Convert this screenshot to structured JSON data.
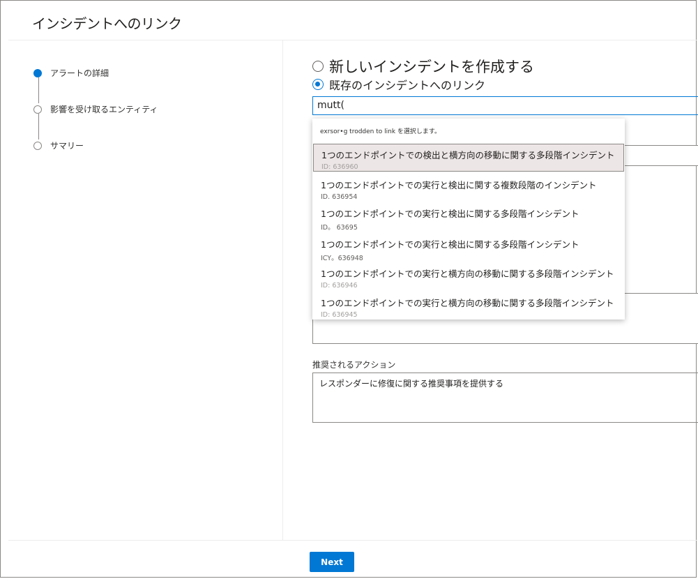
{
  "window": {
    "title": "インシデントへのリンク"
  },
  "steps": [
    {
      "label": "アラートの詳細",
      "active": true
    },
    {
      "label": "影響を受け取るエンティティ",
      "active": false
    },
    {
      "label": "サマリー",
      "active": false
    }
  ],
  "options": {
    "create_new": "新しいインシデントを作成する",
    "link_existing": "既存のインシデントへのリンク",
    "selected": "link_existing"
  },
  "search": {
    "value": "mutt("
  },
  "dropdown": {
    "hint": "exrsor•g trodden to link を選択します。",
    "items": [
      {
        "title": "1つのエンドポイントでの検出と横方向の移動に関する多段階インシデント",
        "id": "ID: 636960",
        "selected": true
      },
      {
        "title": "1つのエンドポイントでの実行と検出に関する複数段階のインシデント",
        "id": "ID. 636954",
        "selected": false
      },
      {
        "title": "1つのエンドポイントでの実行と検出に関する多段階インシデント",
        "id": "ID。 63695",
        "selected": false
      },
      {
        "title": "1つのエンドポイントでの実行と検出に関する多段階インシデント",
        "id": "ICY。636948",
        "selected": false
      },
      {
        "title": "1つのエンドポイントでの実行と横方向の移動に関する多段階インシデント",
        "id": "ID: 636946",
        "selected": false
      },
      {
        "title": "1つのエンドポイントでの実行と横方向の移動に関する多段階インシデント",
        "id": "ID: 636945",
        "selected": false
      }
    ]
  },
  "recommended": {
    "label": "推奨されるアクション",
    "value": "レスポンダーに修復に関する推奨事項を提供する"
  },
  "footer": {
    "next_label": "Next"
  },
  "colors": {
    "accent": "#0078d4",
    "selected_row": "#ede6e6"
  }
}
